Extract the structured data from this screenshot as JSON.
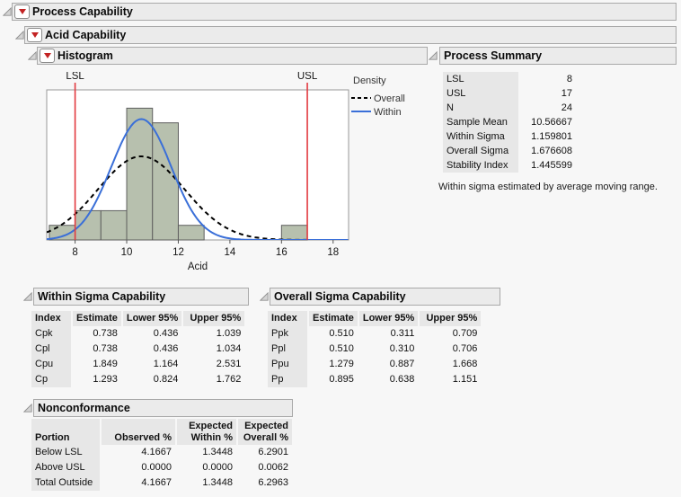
{
  "outline": {
    "process_capability": "Process Capability",
    "acid_capability": "Acid Capability",
    "histogram": "Histogram",
    "process_summary": "Process Summary",
    "within_capability": "Within Sigma Capability",
    "overall_capability": "Overall Sigma Capability",
    "nonconformance": "Nonconformance"
  },
  "colors": {
    "spec_line_red": "#e23a40",
    "within_blue": "#3a6fd8",
    "overall_black": "#000000",
    "bar_fill": "#b7c0ae",
    "bar_border": "#5f5f5f",
    "frame_border": "#9a9a9a",
    "menu_red": "#c32323"
  },
  "chart_data": {
    "type": "histogram",
    "xlabel": "Acid",
    "x_ticks": [
      8,
      10,
      12,
      14,
      16,
      18
    ],
    "x_range": [
      6.9,
      18.6
    ],
    "y_range": [
      0,
      10.25
    ],
    "n": 24,
    "bin_width": 1,
    "bins": [
      {
        "x0": 7,
        "count": 1
      },
      {
        "x0": 8,
        "count": 2
      },
      {
        "x0": 9,
        "count": 2
      },
      {
        "x0": 10,
        "count": 9
      },
      {
        "x0": 11,
        "count": 8
      },
      {
        "x0": 12,
        "count": 1
      },
      {
        "x0": 16,
        "count": 1
      }
    ],
    "spec_limits": [
      {
        "label": "LSL",
        "value": 8
      },
      {
        "label": "USL",
        "value": 17
      }
    ],
    "curves": [
      {
        "name": "Overall",
        "mean": 10.56667,
        "sigma": 1.676608,
        "style": "dashed",
        "color": "#000000"
      },
      {
        "name": "Within",
        "mean": 10.56667,
        "sigma": 1.159801,
        "style": "solid",
        "color": "#3a6fd8"
      }
    ],
    "legend": {
      "title": "Density",
      "entries": [
        {
          "label": "Overall",
          "style": "dashed",
          "color": "#000000"
        },
        {
          "label": "Within",
          "style": "solid",
          "color": "#3a6fd8"
        }
      ]
    }
  },
  "process_summary": {
    "rows": [
      [
        "LSL",
        "8"
      ],
      [
        "USL",
        "17"
      ],
      [
        "N",
        "24"
      ],
      [
        "Sample Mean",
        "10.56667"
      ],
      [
        "Within Sigma",
        "1.159801"
      ],
      [
        "Overall Sigma",
        "1.676608"
      ],
      [
        "Stability Index",
        "1.445599"
      ]
    ],
    "note": "Within sigma estimated by average moving range."
  },
  "within_capability": {
    "headers": [
      "Index",
      "Estimate",
      "Lower 95%",
      "Upper 95%"
    ],
    "rows": [
      [
        "Cpk",
        "0.738",
        "0.436",
        "1.039"
      ],
      [
        "Cpl",
        "0.738",
        "0.436",
        "1.034"
      ],
      [
        "Cpu",
        "1.849",
        "1.164",
        "2.531"
      ],
      [
        "Cp",
        "1.293",
        "0.824",
        "1.762"
      ]
    ]
  },
  "overall_capability": {
    "headers": [
      "Index",
      "Estimate",
      "Lower 95%",
      "Upper 95%"
    ],
    "rows": [
      [
        "Ppk",
        "0.510",
        "0.311",
        "0.709"
      ],
      [
        "Ppl",
        "0.510",
        "0.310",
        "0.706"
      ],
      [
        "Ppu",
        "1.279",
        "0.887",
        "1.668"
      ],
      [
        "Pp",
        "0.895",
        "0.638",
        "1.151"
      ]
    ]
  },
  "nonconformance": {
    "headers": [
      "Portion",
      "Observed %",
      "Expected\nWithin %",
      "Expected\nOverall %"
    ],
    "rows": [
      [
        "Below LSL",
        "4.1667",
        "1.3448",
        "6.2901"
      ],
      [
        "Above USL",
        "0.0000",
        "0.0000",
        "0.0062"
      ],
      [
        "Total Outside",
        "4.1667",
        "1.3448",
        "6.2963"
      ]
    ]
  }
}
